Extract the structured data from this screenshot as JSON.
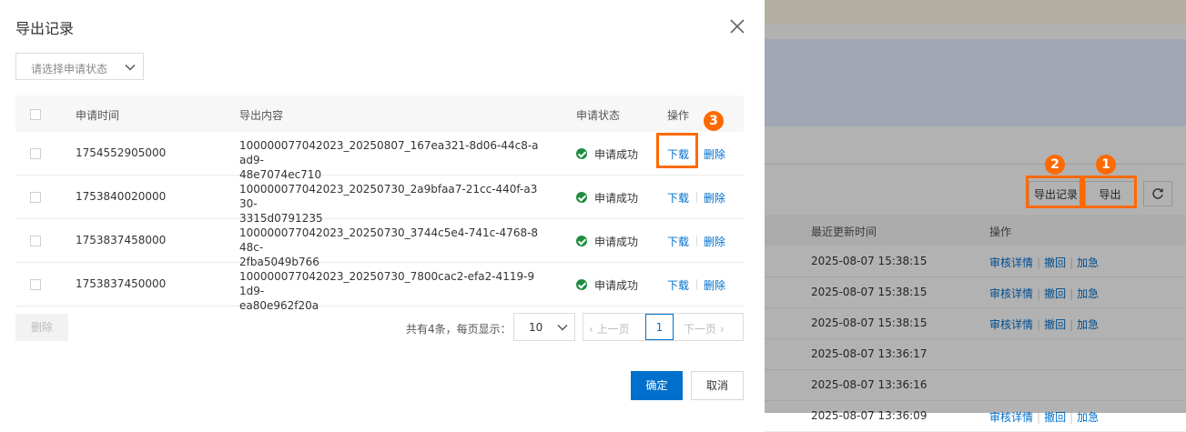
{
  "dialog": {
    "title": "导出记录",
    "filter_placeholder": "请选择申请状态",
    "columns": [
      "申请时间",
      "导出内容",
      "申请状态",
      "操作"
    ],
    "rows": [
      {
        "time": "1754552905000",
        "content_line1": "100000077042023_20250807_167ea321-8d06-44c8-aad9-",
        "content_line2": "48e7074ec710",
        "status": "申请成功",
        "download": "下载",
        "delete": "删除"
      },
      {
        "time": "1753840020000",
        "content_line1": "100000077042023_20250730_2a9bfaa7-21cc-440f-a330-",
        "content_line2": "3315d0791235",
        "status": "申请成功",
        "download": "下载",
        "delete": "删除"
      },
      {
        "time": "1753837458000",
        "content_line1": "100000077042023_20250730_3744c5e4-741c-4768-848c-",
        "content_line2": "2fba5049b766",
        "status": "申请成功",
        "download": "下载",
        "delete": "删除"
      },
      {
        "time": "1753837450000",
        "content_line1": "100000077042023_20250730_7800cac2-efa2-4119-91d9-",
        "content_line2": "ea80e962f20a",
        "status": "申请成功",
        "download": "下载",
        "delete": "删除"
      }
    ],
    "bulk_delete": "删除",
    "total_text": "共有4条，每页显示：",
    "page_size": "10",
    "prev": "上一页",
    "current_page": "1",
    "next": "下一页",
    "ok": "确定",
    "cancel": "取消"
  },
  "background": {
    "export_records_btn": "导出记录",
    "export_btn": "导出",
    "col_update_time": "最近更新时间",
    "col_actions": "操作",
    "rows": [
      {
        "time": "2025-08-07 15:38:15",
        "a1": "审核详情",
        "a2": "撤回",
        "a3": "加急"
      },
      {
        "time": "2025-08-07 15:38:15",
        "a1": "审核详情",
        "a2": "撤回",
        "a3": "加急"
      },
      {
        "time": "2025-08-07 15:38:15",
        "a1": "审核详情",
        "a2": "撤回",
        "a3": "加急"
      },
      {
        "time": "2025-08-07 13:36:17",
        "a1": "",
        "a2": "",
        "a3": ""
      },
      {
        "time": "2025-08-07 13:36:16",
        "a1": "",
        "a2": "",
        "a3": ""
      },
      {
        "time": "2025-08-07 13:36:09",
        "a1": "审核详情",
        "a2": "撤回",
        "a3": "加急"
      }
    ]
  },
  "annotations": [
    "1",
    "2",
    "3"
  ],
  "colors": {
    "accent": "#ff6a00",
    "primary": "#0070cc",
    "success": "#1e8e3e"
  }
}
